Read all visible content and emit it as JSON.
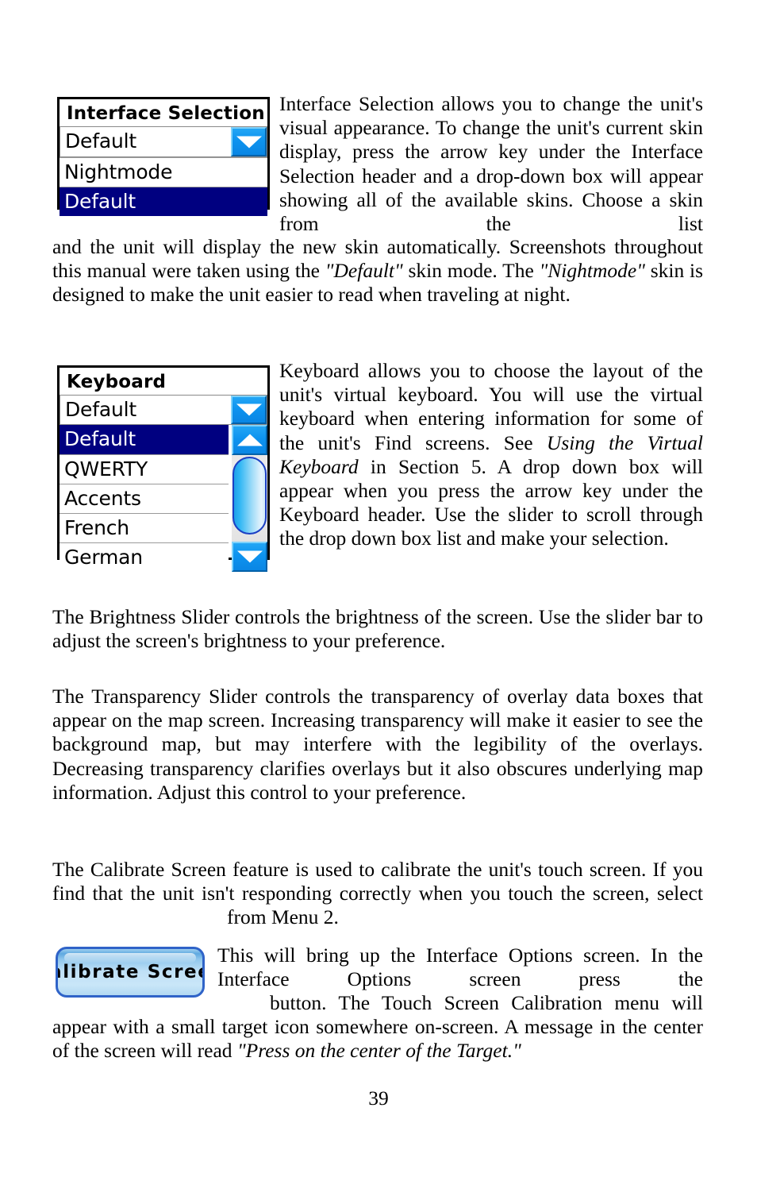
{
  "page": {
    "number": "39"
  },
  "interface_selection_widget": {
    "title": "Interface Selection",
    "selected_value": "Default",
    "dropdown_icon": "chevron-down-icon",
    "options": [
      {
        "label": "Nightmode",
        "selected": false
      },
      {
        "label": "Default",
        "selected": true
      }
    ]
  },
  "keyboard_widget": {
    "title": "Keyboard",
    "selected_value": "Default",
    "dropdown_icon": "chevron-down-icon",
    "scroll_up_icon": "chevron-up-icon",
    "scroll_down_icon": "chevron-down-icon",
    "options": [
      {
        "label": "Default",
        "selected": true
      },
      {
        "label": "QWERTY",
        "selected": false
      },
      {
        "label": "Accents",
        "selected": false
      },
      {
        "label": "French",
        "selected": false
      },
      {
        "label": "German",
        "selected": false
      }
    ]
  },
  "calibrate_button": {
    "label": "Calibrate  Screen"
  },
  "body": {
    "p1_wrapped": "Interface Selection allows you to change the unit's visual appearance. To change the unit's current skin display, press the arrow key under the Interface Selection header and a drop-down box will appear showing all of the available skins. Choose a skin from the list",
    "p1_full_a": "and the unit will display the new skin automatically. Screenshots throughout this manual were taken using the ",
    "p1_italic_default": "\"Default\"",
    "p1_full_b": " skin mode. The ",
    "p1_italic_nightmode": "\"Nightmode\"",
    "p1_full_c": " skin is designed to make the unit easier to read when traveling at night.",
    "p2_wrapped_a": "Keyboard allows you to choose the layout of the unit's virtual keyboard. You will use the virtual keyboard when entering information for some of the unit's Find screens. See ",
    "p2_italic_using": "Using the Virtual Keyboard",
    "p2_wrapped_b": " in Section 5. A drop down box will appear when you press the arrow key under the Keyboard header. Use the slider to scroll through the drop down box list and make your selection.",
    "p3": "The Brightness Slider controls the brightness of the screen. Use the slider bar to adjust the screen's brightness to your preference.",
    "p4": "The Transparency Slider controls the transparency of overlay data boxes that appear on the map screen. Increasing transparency will make it easier to see the background map, but may interfere with the legibility of the overlays. Decreasing transparency clarifies overlays but it also obscures underlying map information. Adjust this control to your preference.",
    "p5_a": "The Calibrate Screen feature is used to calibrate the unit's touch screen. If you find that the unit isn't responding correctly when you touch the screen, select",
    "p5_b": "from Menu 2.",
    "p6_a": "This will bring up the Interface Options screen. In the Interface Options screen press the",
    "p6_b": "button. The Touch Screen Calibration menu will appear with a small target icon somewhere on-screen. A message in the center of the screen will read ",
    "p6_italic_press": "\"Press on the center of the Target.\""
  }
}
